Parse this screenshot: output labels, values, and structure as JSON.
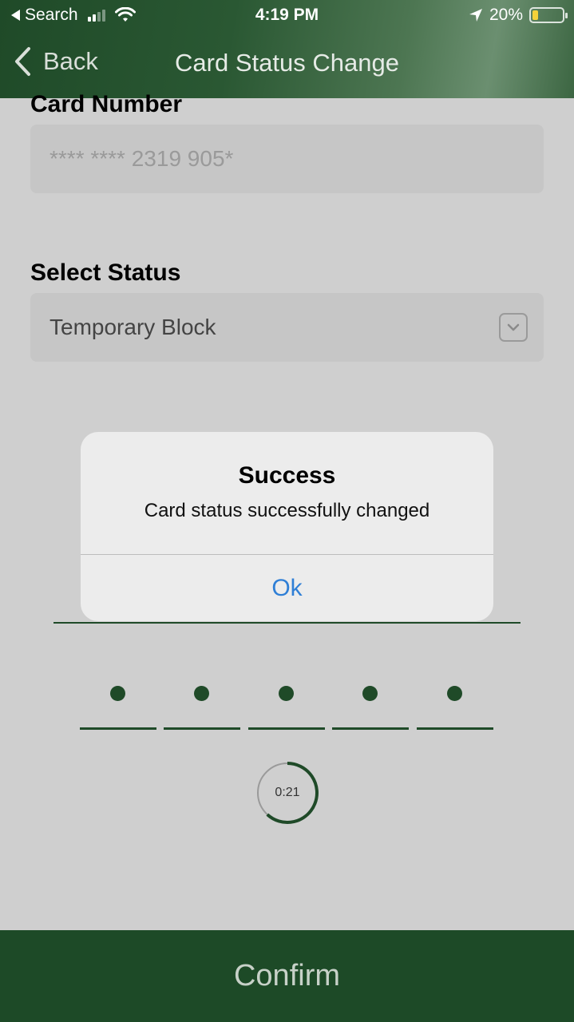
{
  "status_bar": {
    "back_app": "Search",
    "time": "4:19 PM",
    "battery": "20%",
    "battery_level": 0.2
  },
  "nav": {
    "back_label": "Back",
    "title": "Card Status Change"
  },
  "form": {
    "card_number_label": "Card Number",
    "card_number_value": "**** **** 2319 905*",
    "status_label": "Select Status",
    "status_value": "Temporary Block"
  },
  "otp": {
    "filled_digits": 5,
    "timer": "0:21"
  },
  "dialog": {
    "title": "Success",
    "message": "Card status successfully changed",
    "ok_label": "Ok"
  },
  "footer": {
    "confirm_label": "Confirm"
  },
  "colors": {
    "primary_green": "#1d4a27",
    "link_blue": "#2f7fd6",
    "battery_yellow": "#f5d23a"
  }
}
